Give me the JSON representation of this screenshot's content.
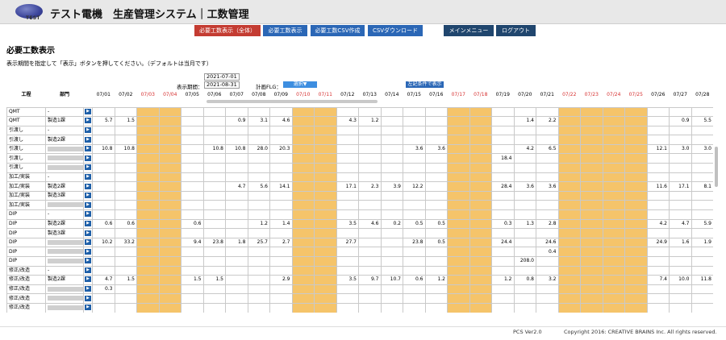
{
  "header": {
    "logo_text": "TEST",
    "title": "テスト電機　生産管理システム｜工数管理"
  },
  "topnav": {
    "items": [
      {
        "label": "必要工数表示（全体）",
        "color": "#c43c32"
      },
      {
        "label": "必要工数表示",
        "color": "#2b67b6"
      },
      {
        "label": "必要工数CSV作成",
        "color": "#2b67b6"
      },
      {
        "label": "CSVダウンロード",
        "color": "#2b67b6"
      },
      {
        "label": "メインメニュー",
        "color": "#20466e"
      },
      {
        "label": "ログアウト",
        "color": "#20466e"
      }
    ]
  },
  "page": {
    "title": "必要工数表示",
    "instruction": "表示期間を指定して「表示」ボタンを押してください。（デフォルトは当月です）"
  },
  "controls": {
    "period_label": "表示期間：",
    "date_from": "2021-07-01",
    "date_to": "2021-08-31",
    "plan_flg_label": "計画FLG：",
    "select_label": "選択▼",
    "filter_button": "左記条件で表示"
  },
  "grid": {
    "col_process": "工程",
    "col_dept": "部門",
    "dates": [
      "07/01",
      "07/02",
      "07/03",
      "07/04",
      "07/05",
      "07/06",
      "07/07",
      "07/08",
      "07/09",
      "07/10",
      "07/11",
      "07/12",
      "07/13",
      "07/14",
      "07/15",
      "07/16",
      "07/17",
      "07/18",
      "07/19",
      "07/20",
      "07/21",
      "07/22",
      "07/23",
      "07/24",
      "07/25",
      "07/26",
      "07/27",
      "07/28"
    ],
    "holidays": [
      "07/03",
      "07/04",
      "07/10",
      "07/11",
      "07/17",
      "07/18",
      "07/22",
      "07/23",
      "07/24",
      "07/25"
    ],
    "highlight_color": "#f5c46a",
    "rows": [
      {
        "process": "QMT",
        "dept": "-",
        "values": [
          "",
          "",
          "",
          "",
          "",
          "",
          "",
          "",
          "",
          "",
          "",
          "",
          "",
          "",
          "",
          "",
          "",
          "",
          "",
          "",
          "",
          "",
          "",
          "",
          "",
          "",
          "",
          ""
        ]
      },
      {
        "process": "QMT",
        "dept": "製造1課",
        "values": [
          "5.7",
          "1.5",
          "",
          "",
          "",
          "",
          "0.9",
          "3.1",
          "4.6",
          "",
          "",
          "4.3",
          "1.2",
          "",
          "",
          "",
          "",
          "",
          "",
          "1.4",
          "2.2",
          "",
          "",
          "",
          "",
          "",
          "0.9",
          "5.5"
        ]
      },
      {
        "process": "引渡し",
        "dept": "-",
        "values": [
          "",
          "",
          "",
          "",
          "",
          "",
          "",
          "",
          "",
          "",
          "",
          "",
          "",
          "",
          "",
          "",
          "",
          "",
          "",
          "",
          "",
          "",
          "",
          "",
          "",
          "",
          "",
          ""
        ]
      },
      {
        "process": "引渡し",
        "dept": "製造2課",
        "values": [
          "",
          "",
          "",
          "",
          "",
          "",
          "",
          "",
          "",
          "",
          "",
          "",
          "",
          "",
          "",
          "",
          "",
          "",
          "",
          "",
          "",
          "",
          "",
          "",
          "",
          "",
          "",
          ""
        ]
      },
      {
        "process": "引渡し",
        "dept": "",
        "redacted": true,
        "values": [
          "10.8",
          "10.8",
          "",
          "",
          "",
          "10.8",
          "10.8",
          "28.0",
          "20.3",
          "",
          "",
          "",
          "",
          "",
          "3.6",
          "3.6",
          "",
          "",
          "",
          "4.2",
          "6.5",
          "",
          "",
          "",
          "",
          "12.1",
          "3.0",
          "3.0"
        ]
      },
      {
        "process": "引渡し",
        "dept": "",
        "redacted": true,
        "values": [
          "",
          "",
          "",
          "",
          "",
          "",
          "",
          "",
          "",
          "",
          "",
          "",
          "",
          "",
          "",
          "",
          "",
          "",
          "18.4",
          "",
          "",
          "",
          "",
          "",
          "",
          "",
          "",
          ""
        ]
      },
      {
        "process": "引渡し",
        "dept": "",
        "redacted": true,
        "values": [
          "",
          "",
          "",
          "",
          "",
          "",
          "",
          "",
          "",
          "",
          "",
          "",
          "",
          "",
          "",
          "",
          "",
          "",
          "",
          "",
          "",
          "",
          "",
          "",
          "",
          "",
          "",
          ""
        ]
      },
      {
        "process": "加工/実装",
        "dept": "-",
        "values": [
          "",
          "",
          "",
          "",
          "",
          "",
          "",
          "",
          "",
          "",
          "",
          "",
          "",
          "",
          "",
          "",
          "",
          "",
          "",
          "",
          "",
          "",
          "",
          "",
          "",
          "",
          "",
          ""
        ]
      },
      {
        "process": "加工/実装",
        "dept": "製造2課",
        "values": [
          "",
          "",
          "",
          "",
          "",
          "",
          "4.7",
          "5.6",
          "14.1",
          "",
          "",
          "17.1",
          "2.3",
          "3.9",
          "12.2",
          "",
          "",
          "",
          "28.4",
          "3.6",
          "3.6",
          "",
          "",
          "",
          "",
          "11.6",
          "17.1",
          "8.1"
        ]
      },
      {
        "process": "加工/実装",
        "dept": "製造3課",
        "values": [
          "",
          "",
          "",
          "",
          "",
          "",
          "",
          "",
          "",
          "",
          "",
          "",
          "",
          "",
          "",
          "",
          "",
          "",
          "",
          "",
          "",
          "",
          "",
          "",
          "",
          "",
          "",
          ""
        ]
      },
      {
        "process": "加工/実装",
        "dept": "",
        "redacted": true,
        "values": [
          "",
          "",
          "",
          "",
          "",
          "",
          "",
          "",
          "",
          "",
          "",
          "",
          "",
          "",
          "",
          "",
          "",
          "",
          "",
          "",
          "",
          "",
          "",
          "",
          "",
          "",
          "",
          ""
        ]
      },
      {
        "process": "DIP",
        "dept": "-",
        "values": [
          "",
          "",
          "",
          "",
          "",
          "",
          "",
          "",
          "",
          "",
          "",
          "",
          "",
          "",
          "",
          "",
          "",
          "",
          "",
          "",
          "",
          "",
          "",
          "",
          "",
          "",
          "",
          ""
        ]
      },
      {
        "process": "DIP",
        "dept": "製造2課",
        "values": [
          "0.6",
          "0.6",
          "",
          "",
          "0.6",
          "",
          "",
          "1.2",
          "1.4",
          "",
          "",
          "3.5",
          "4.6",
          "0.2",
          "0.5",
          "0.5",
          "",
          "",
          "0.3",
          "1.3",
          "2.8",
          "",
          "",
          "",
          "",
          "4.2",
          "4.7",
          "5.9"
        ]
      },
      {
        "process": "DIP",
        "dept": "製造3課",
        "values": [
          "",
          "",
          "",
          "",
          "",
          "",
          "",
          "",
          "",
          "",
          "",
          "",
          "",
          "",
          "",
          "",
          "",
          "",
          "",
          "",
          "",
          "",
          "",
          "",
          "",
          "",
          "",
          ""
        ]
      },
      {
        "process": "DIP",
        "dept": "",
        "redacted": true,
        "values": [
          "10.2",
          "33.2",
          "",
          "",
          "9.4",
          "23.8",
          "1.8",
          "25.7",
          "2.7",
          "",
          "",
          "27.7",
          "",
          "",
          "23.8",
          "0.5",
          "",
          "",
          "24.4",
          "",
          "24.6",
          "",
          "",
          "",
          "",
          "24.9",
          "1.6",
          "1.9"
        ]
      },
      {
        "process": "DIP",
        "dept": "",
        "redacted": true,
        "values": [
          "",
          "",
          "",
          "",
          "",
          "",
          "",
          "",
          "",
          "",
          "",
          "",
          "",
          "",
          "",
          "",
          "",
          "",
          "",
          "",
          "0.4",
          "",
          "",
          "",
          "",
          "",
          "",
          ""
        ]
      },
      {
        "process": "DIP",
        "dept": "",
        "redacted": true,
        "values": [
          "",
          "",
          "",
          "",
          "",
          "",
          "",
          "",
          "",
          "",
          "",
          "",
          "",
          "",
          "",
          "",
          "",
          "",
          "",
          "208.0",
          "",
          "",
          "",
          "",
          "",
          "",
          "",
          ""
        ]
      },
      {
        "process": "修正/改造",
        "dept": "-",
        "values": [
          "",
          "",
          "",
          "",
          "",
          "",
          "",
          "",
          "",
          "",
          "",
          "",
          "",
          "",
          "",
          "",
          "",
          "",
          "",
          "",
          "",
          "",
          "",
          "",
          "",
          "",
          "",
          ""
        ]
      },
      {
        "process": "修正/改造",
        "dept": "製造2課",
        "values": [
          "4.7",
          "1.5",
          "",
          "",
          "1.5",
          "1.5",
          "",
          "",
          "2.9",
          "",
          "",
          "3.5",
          "9.7",
          "10.7",
          "0.6",
          "1.2",
          "",
          "",
          "1.2",
          "0.8",
          "3.2",
          "",
          "",
          "",
          "",
          "7.4",
          "10.0",
          "11.8"
        ]
      },
      {
        "process": "修正/改造",
        "dept": "",
        "redacted": true,
        "values": [
          "0.3",
          "",
          "",
          "",
          "",
          "",
          "",
          "",
          "",
          "",
          "",
          "",
          "",
          "",
          "",
          "",
          "",
          "",
          "",
          "",
          "",
          "",
          "",
          "",
          "",
          "",
          "",
          ""
        ]
      },
      {
        "process": "修正/改造",
        "dept": "",
        "redacted": true,
        "values": [
          "",
          "",
          "",
          "",
          "",
          "",
          "",
          "",
          "",
          "",
          "",
          "",
          "",
          "",
          "",
          "",
          "",
          "",
          "",
          "",
          "",
          "",
          "",
          "",
          "",
          "",
          "",
          ""
        ]
      },
      {
        "process": "修正/改造",
        "dept": "",
        "redacted": true,
        "values": [
          "",
          "",
          "",
          "",
          "",
          "",
          "",
          "",
          "",
          "",
          "",
          "",
          "",
          "",
          "",
          "",
          "",
          "",
          "",
          "",
          "",
          "",
          "",
          "",
          "",
          "",
          "",
          ""
        ]
      },
      {
        "process": "仕上げ",
        "dept": "-",
        "values": [
          "",
          "",
          "",
          "",
          "",
          "",
          "",
          "",
          "",
          "",
          "",
          "",
          "",
          "",
          "",
          "",
          "",
          "",
          "",
          "",
          "",
          "",
          "",
          "",
          "",
          "",
          "",
          ""
        ]
      }
    ]
  },
  "footer": {
    "version": "PCS Ver2.0",
    "copyright": "Copyright 2016: CREATIVE BRAINS Inc. All rights reserved."
  },
  "icons": {
    "logo": "test-logo-icon",
    "row_arrow": "play-arrow-icon"
  }
}
